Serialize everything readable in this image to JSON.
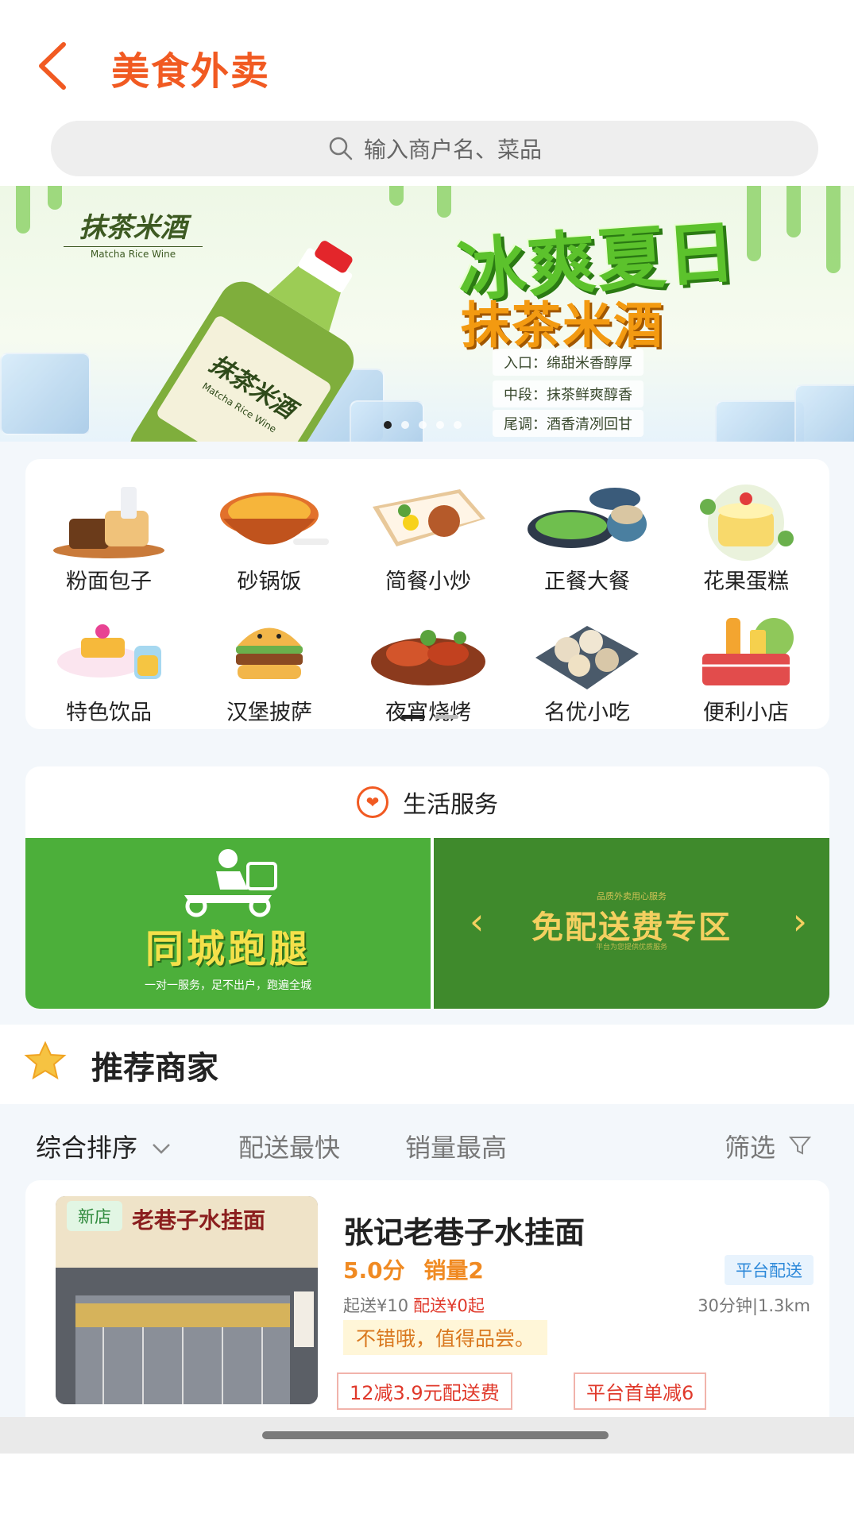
{
  "header": {
    "title": "美食外卖",
    "back_icon": "chevron-left-icon"
  },
  "search": {
    "placeholder": "输入商户名、菜品",
    "icon": "search-icon"
  },
  "banner": {
    "brand_cn": "抹茶米酒",
    "brand_en": "Matcha Rice Wine",
    "headline": "冰爽夏日",
    "product": "抹茶米酒",
    "notes": [
      "入口：绵甜米香醇厚",
      "中段：抹茶鲜爽醇香",
      "尾调：酒香清冽回甘"
    ],
    "slide_count": 5,
    "active_slide": 1
  },
  "categories": [
    {
      "label": "粉面包子",
      "icon": "bread-icon"
    },
    {
      "label": "砂锅饭",
      "icon": "claypot-icon"
    },
    {
      "label": "简餐小炒",
      "icon": "bento-icon"
    },
    {
      "label": "正餐大餐",
      "icon": "feast-icon"
    },
    {
      "label": "花果蛋糕",
      "icon": "cake-icon"
    },
    {
      "label": "特色饮品",
      "icon": "drink-icon"
    },
    {
      "label": "汉堡披萨",
      "icon": "burger-icon"
    },
    {
      "label": "夜宵烧烤",
      "icon": "bbq-icon"
    },
    {
      "label": "名优小吃",
      "icon": "snack-icon"
    },
    {
      "label": "便利小店",
      "icon": "basket-icon"
    }
  ],
  "life_service": {
    "title": "生活服务",
    "run": {
      "title": "同城跑腿",
      "subtitle": "一对一服务，足不出户，跑遍全城"
    },
    "free": {
      "title": "免配送费专区",
      "top_text": "品质外卖用心服务",
      "bottom_text": "平台为您提供优质服务"
    }
  },
  "recommend": {
    "title": "推荐商家",
    "filters": {
      "sort": "综合排序",
      "fastest": "配送最快",
      "sales": "销量最高",
      "filter": "筛选"
    }
  },
  "shop": {
    "badge": "新店",
    "sign_text": "老巷子水挂面",
    "name": "张记老巷子水挂面",
    "score": "5.0分",
    "sales": "销量2",
    "delivery_tag": "平台配送",
    "min_order": "起送¥10",
    "delivery_fee": "配送¥0起",
    "distance": "30分钟|1.3km",
    "review": "不错哦，值得品尝。",
    "coupons": [
      "12减3.9元配送费",
      "平台首单减6"
    ]
  },
  "colors": {
    "accent": "#f15a22",
    "green": "#4caf3a",
    "dark_green": "#3f8a2c",
    "sale_red": "#e0392b",
    "score_orange": "#f08a22"
  }
}
